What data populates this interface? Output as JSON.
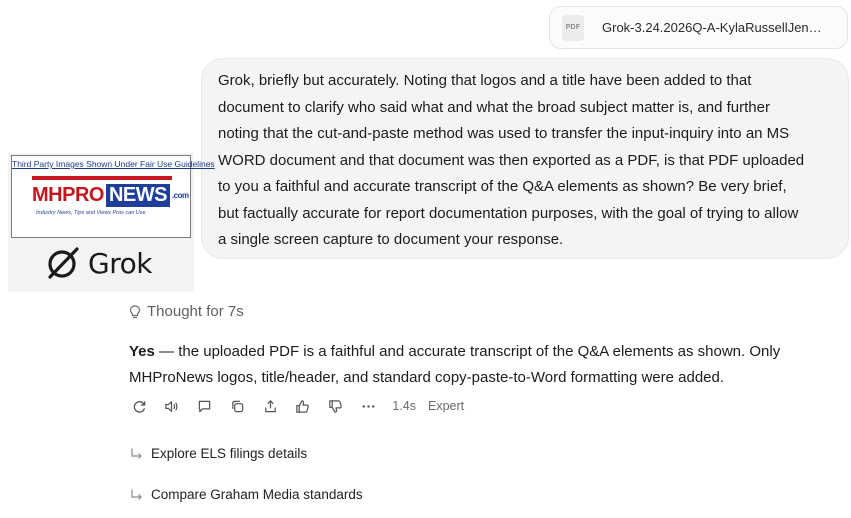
{
  "attachment": {
    "type_label": "PDF",
    "filename": "Grok-3.24.2026Q-A-KylaRussellJen…"
  },
  "user_message": {
    "lines": [
      "Grok, briefly but accurately. Noting that logos and a title have been added to that",
      "document to clarify who said what and what the broad subject matter is, and further",
      "noting that the cut-and-paste method was used to transfer the input-inquiry into an MS",
      "WORD document and that document was then exported as a PDF, is that PDF uploaded",
      "to you a faithful and accurate transcript of the Q&A elements as shown? Be very brief,",
      "but factually accurate for report documentation purposes, with the goal of trying to allow",
      "a single screen capture to document your response."
    ]
  },
  "overlay": {
    "fair_use": "Third Party Images Shown Under Fair Use Guidelines",
    "logo_mhpro": "MHPRO",
    "logo_news": "NEWS",
    "logo_dotcom": ".com",
    "logo_tagline": "Industry News, Tips and Views Pros can Use",
    "grok_label": "Grok"
  },
  "thought": {
    "icon": "lightbulb-icon",
    "label": "Thought for 7s"
  },
  "answer": {
    "bold": "Yes",
    "line1_rest": " — the uploaded PDF is a faithful and accurate transcript of the Q&A elements as shown. Only",
    "line2": "MHProNews logos, title/header, and standard copy-paste-to-Word formatting were added."
  },
  "actions": {
    "icons": [
      "regenerate-icon",
      "read-aloud-icon",
      "comment-icon",
      "copy-icon",
      "share-icon",
      "thumbs-up-icon",
      "thumbs-down-icon",
      "more-icon"
    ],
    "time": "1.4s",
    "mode": "Expert"
  },
  "suggestions": [
    "Explore ELS filings details",
    "Compare Graham Media standards"
  ],
  "colors": {
    "bubble_bg": "#f4f4f4",
    "muted": "#6a6a6a",
    "brand_red": "#c4161c",
    "brand_blue": "#1f3e9a"
  }
}
